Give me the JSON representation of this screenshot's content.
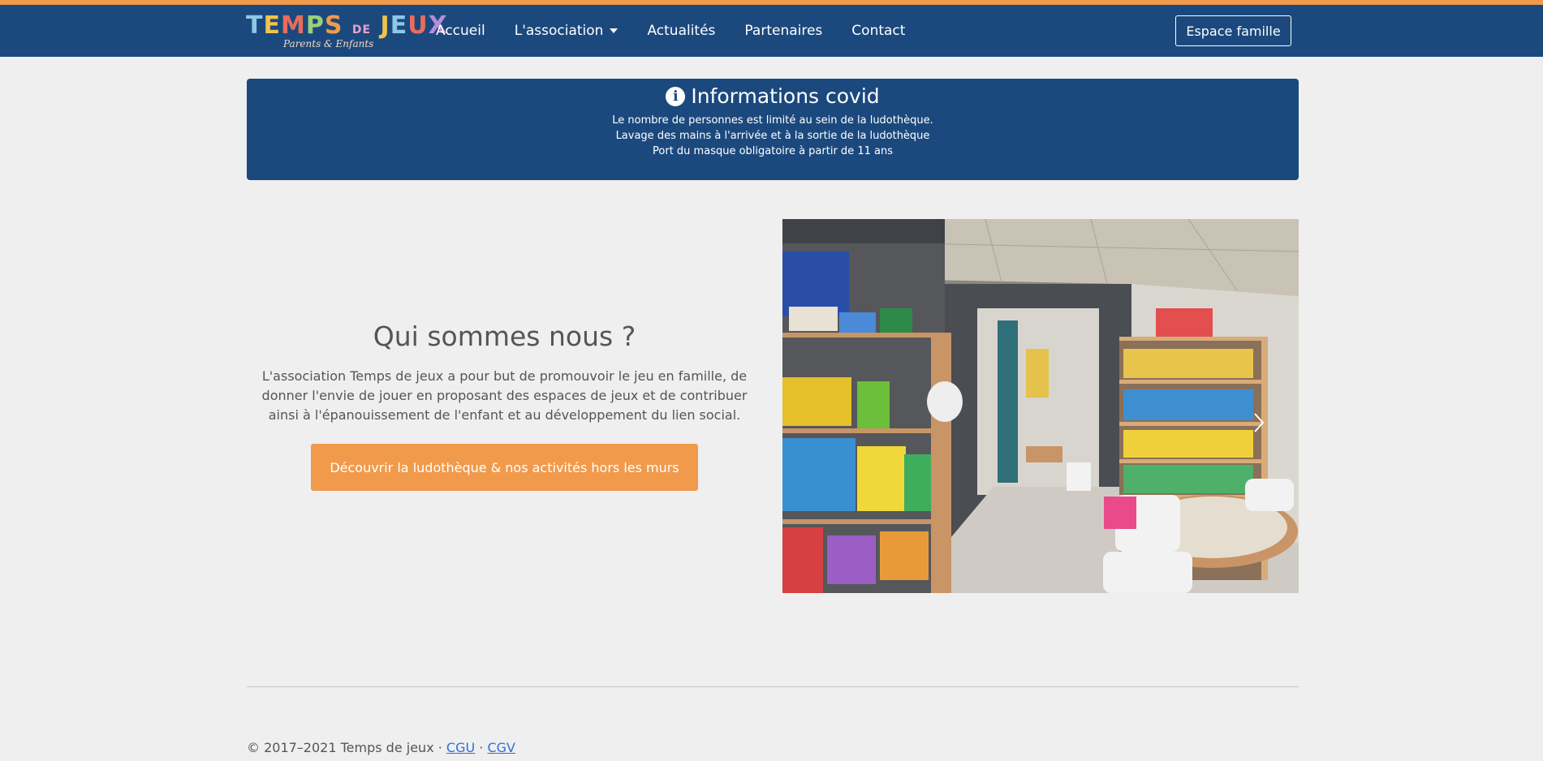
{
  "colors": {
    "brand_blue": "#1b497e",
    "accent_orange": "#f19a4b",
    "background": "#efefef"
  },
  "logo": {
    "title": "TEMPS DE JEUX",
    "subtitle": "Parents & Enfants"
  },
  "nav": {
    "items": [
      {
        "label": "Accueil"
      },
      {
        "label": "L'association",
        "has_dropdown": true
      },
      {
        "label": "Actualités"
      },
      {
        "label": "Partenaires"
      },
      {
        "label": "Contact"
      }
    ],
    "family_button": "Espace famille"
  },
  "covid": {
    "icon": "info-circle-icon",
    "title": "Informations covid",
    "lines": [
      "Le nombre de personnes est limité au sein de la ludothèque.",
      "Lavage des mains à l'arrivée et à la sortie de la ludothèque",
      "Port du masque obligatoire à partir de 11 ans"
    ]
  },
  "about": {
    "title": "Qui sommes nous ?",
    "text": "L'association Temps de jeux a pour but de promouvoir le jeu en famille, de donner l'envie de jouer en proposant des espaces de jeux et de contribuer ainsi à l'épanouissement de l'enfant et au développement du lien social.",
    "cta": "Découvrir la ludothèque & nos activités hors les murs"
  },
  "carousel": {
    "next_icon": "chevron-right-icon"
  },
  "footer": {
    "copyright": "© 2017–2021 Temps de jeux · ",
    "cgu": "CGU",
    "separator": " · ",
    "cgv": "CGV"
  }
}
